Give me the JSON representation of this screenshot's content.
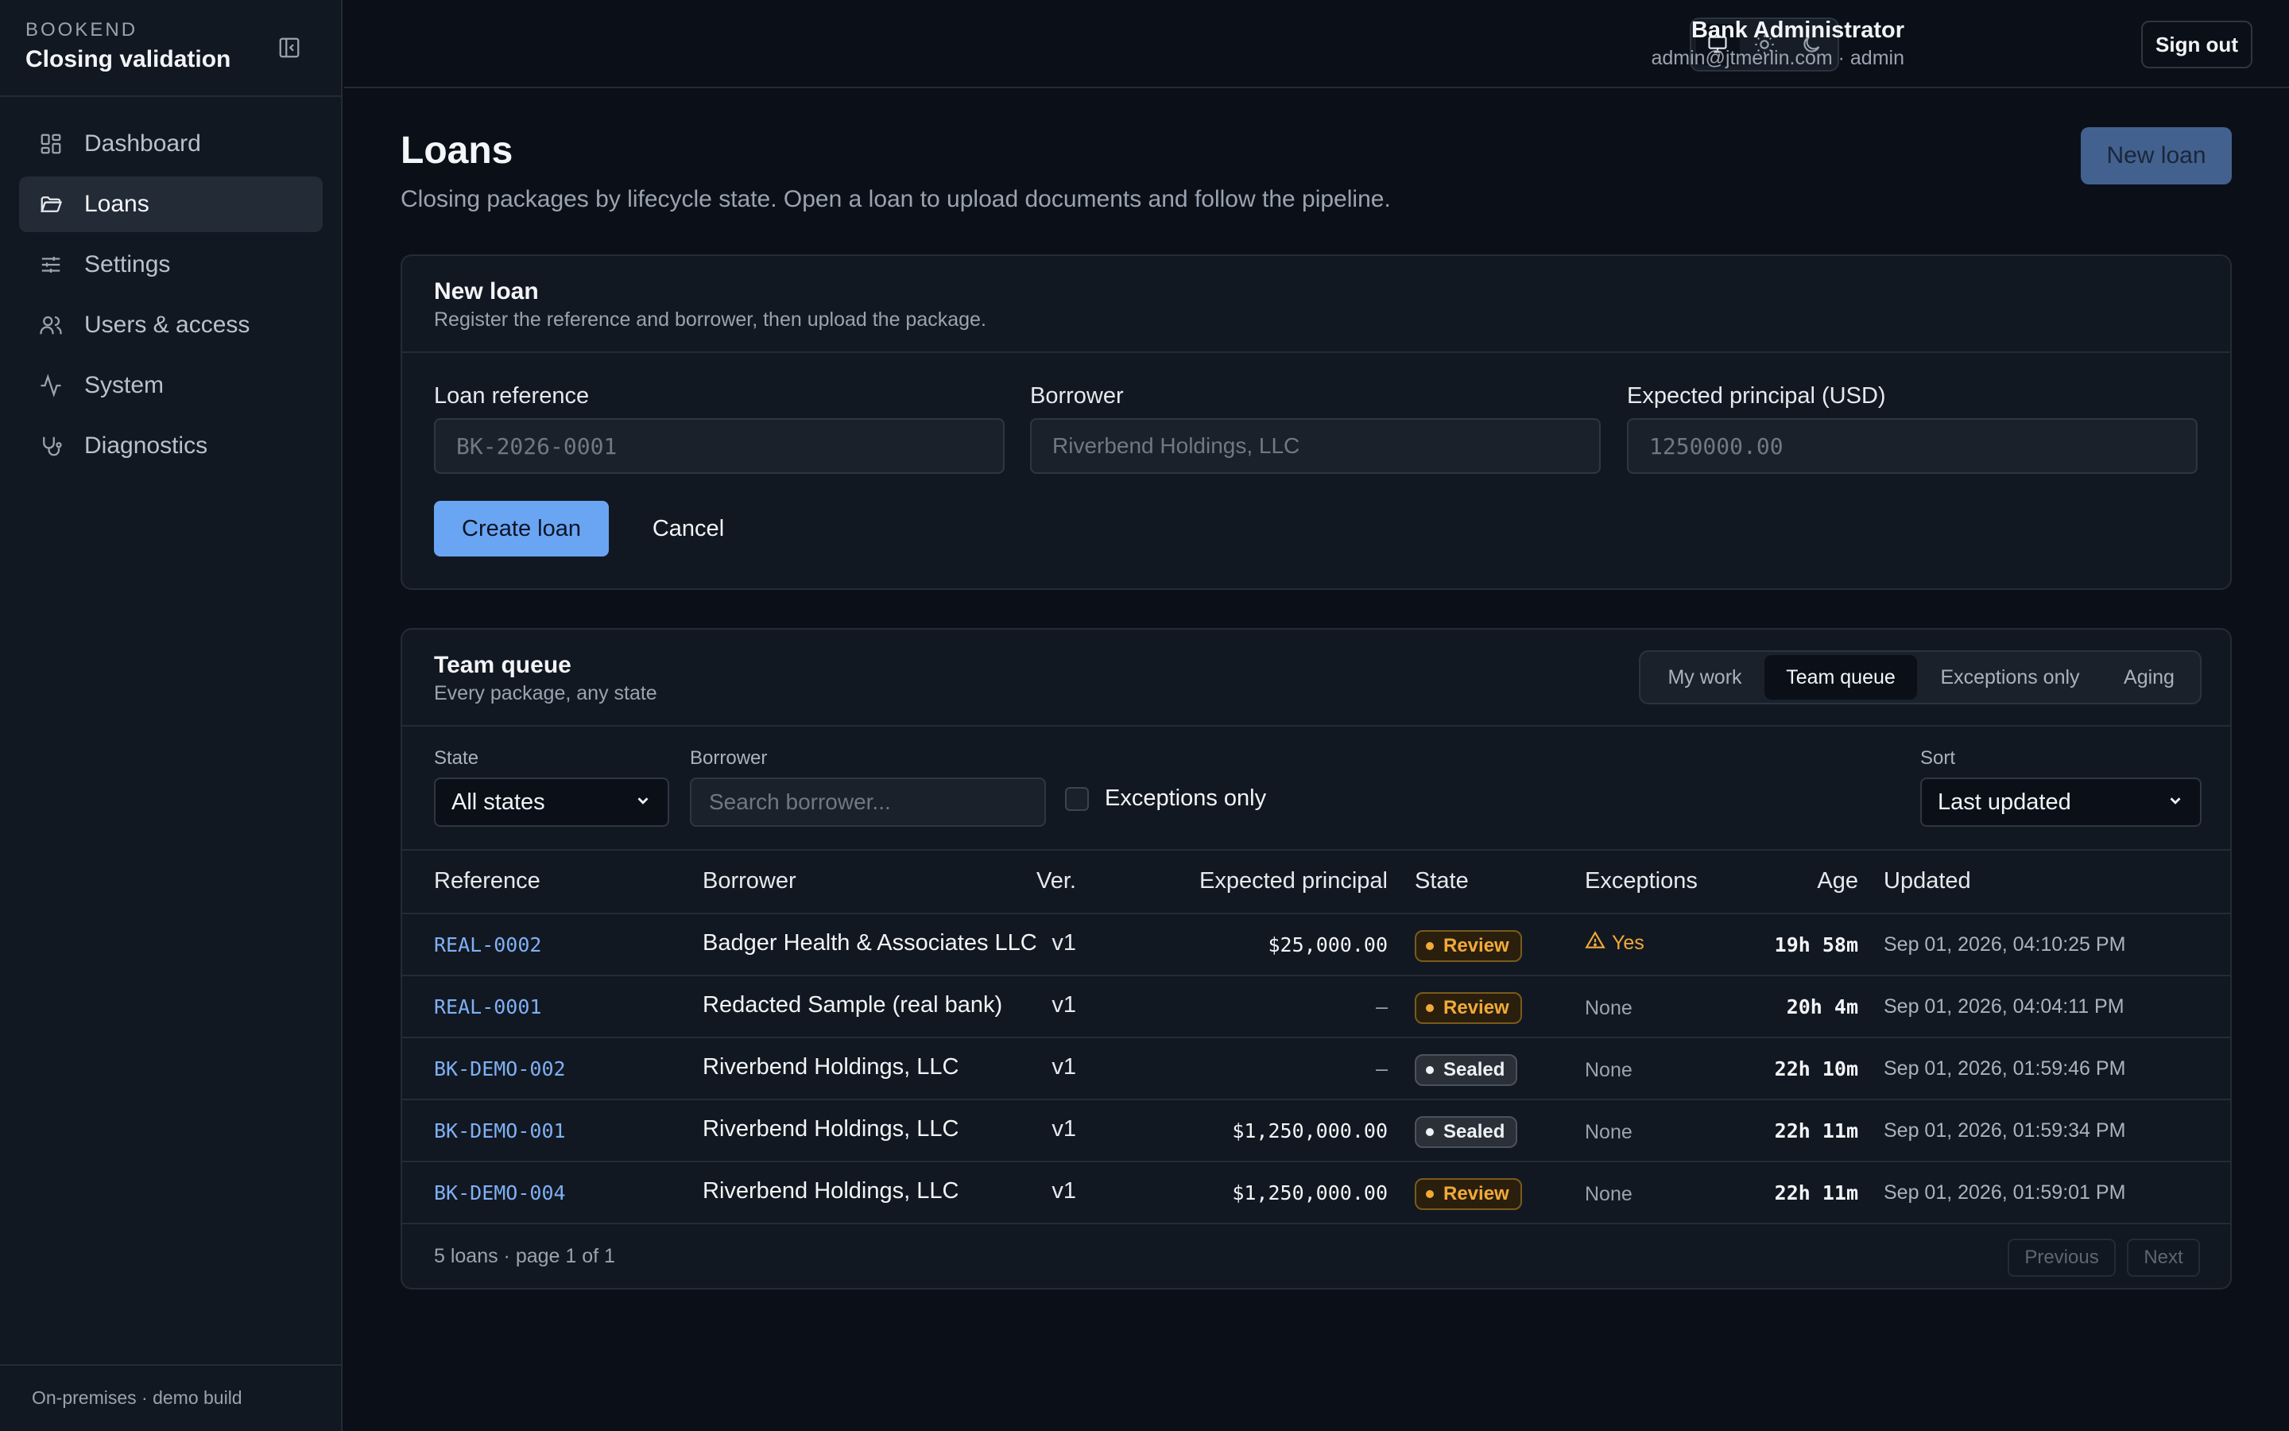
{
  "sidebar": {
    "brand_top": "BOOKEND",
    "brand_name": "Closing validation",
    "items": [
      {
        "label": "Dashboard",
        "icon": "grid-icon"
      },
      {
        "label": "Loans",
        "icon": "folder-icon",
        "active": true
      },
      {
        "label": "Settings",
        "icon": "sliders-icon"
      },
      {
        "label": "Users & access",
        "icon": "users-icon"
      },
      {
        "label": "System",
        "icon": "activity-icon"
      },
      {
        "label": "Diagnostics",
        "icon": "stethoscope-icon"
      }
    ],
    "footer": "On-premises · demo build"
  },
  "topbar": {
    "theme_options": [
      "system",
      "light",
      "dark"
    ],
    "active_theme": "system",
    "user_name": "Bank Administrator",
    "user_email": "admin@jtmerlin.com · admin",
    "signout_label": "Sign out"
  },
  "page": {
    "title": "Loans",
    "subtitle": "Closing packages by lifecycle state. Open a loan to upload documents and follow the pipeline.",
    "new_loan_button": "New loan"
  },
  "new_loan_form": {
    "title": "New loan",
    "subtitle": "Register the reference and borrower, then upload the package.",
    "fields": {
      "reference": {
        "label": "Loan reference",
        "placeholder": "BK-2026-0001"
      },
      "borrower": {
        "label": "Borrower",
        "placeholder": "Riverbend Holdings, LLC"
      },
      "principal": {
        "label": "Expected principal (USD)",
        "placeholder": "1250000.00"
      }
    },
    "create_label": "Create loan",
    "cancel_label": "Cancel"
  },
  "queue": {
    "title": "Team queue",
    "subtitle": "Every package, any state",
    "tabs": [
      "My work",
      "Team queue",
      "Exceptions only",
      "Aging"
    ],
    "active_tab": "Team queue",
    "filters": {
      "state_label": "State",
      "state_value": "All states",
      "borrower_label": "Borrower",
      "borrower_placeholder": "Search borrower...",
      "exceptions_label": "Exceptions only",
      "sort_label": "Sort",
      "sort_value": "Last updated"
    },
    "columns": [
      "Reference",
      "Ver.",
      "Borrower",
      "Expected principal",
      "State",
      "Exceptions",
      "Age",
      "Updated"
    ],
    "rows": [
      {
        "ref": "REAL-0002",
        "ver": "v1",
        "borrower": "Badger Health & Associates LLC",
        "principal": "$25,000.00",
        "state": "Review",
        "exceptions": "Yes",
        "age": "19h 58m",
        "updated": "Sep 01, 2026, 04:10:25 PM"
      },
      {
        "ref": "REAL-0001",
        "ver": "v1",
        "borrower": "Redacted Sample (real bank)",
        "principal": "–",
        "state": "Review",
        "exceptions": "None",
        "age": "20h 4m",
        "updated": "Sep 01, 2026, 04:04:11 PM"
      },
      {
        "ref": "BK-DEMO-002",
        "ver": "v1",
        "borrower": "Riverbend Holdings, LLC",
        "principal": "–",
        "state": "Sealed",
        "exceptions": "None",
        "age": "22h 10m",
        "updated": "Sep 01, 2026, 01:59:46 PM"
      },
      {
        "ref": "BK-DEMO-001",
        "ver": "v1",
        "borrower": "Riverbend Holdings, LLC",
        "principal": "$1,250,000.00",
        "state": "Sealed",
        "exceptions": "None",
        "age": "22h 11m",
        "updated": "Sep 01, 2026, 01:59:34 PM"
      },
      {
        "ref": "BK-DEMO-004",
        "ver": "v1",
        "borrower": "Riverbend Holdings, LLC",
        "principal": "$1,250,000.00",
        "state": "Review",
        "exceptions": "None",
        "age": "22h 11m",
        "updated": "Sep 01, 2026, 01:59:01 PM"
      }
    ],
    "footer_count": "5 loans · page 1 of 1",
    "prev_label": "Previous",
    "next_label": "Next"
  },
  "colors": {
    "background": "#0b1018",
    "surface": "#121821",
    "accent": "#6aa5f4",
    "review": "#f1a93a",
    "link": "#7fb0f5"
  }
}
